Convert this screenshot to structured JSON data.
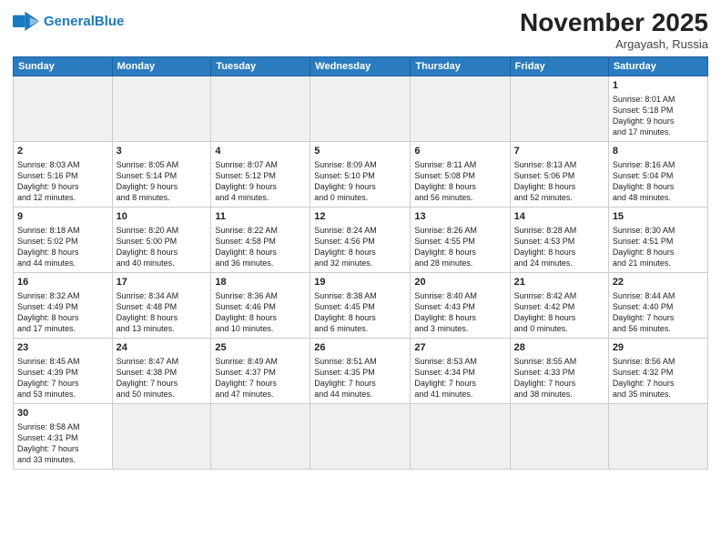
{
  "header": {
    "logo_general": "General",
    "logo_blue": "Blue",
    "month_title": "November 2025",
    "location": "Argayash, Russia"
  },
  "weekdays": [
    "Sunday",
    "Monday",
    "Tuesday",
    "Wednesday",
    "Thursday",
    "Friday",
    "Saturday"
  ],
  "weeks": [
    [
      {
        "day": "",
        "info": ""
      },
      {
        "day": "",
        "info": ""
      },
      {
        "day": "",
        "info": ""
      },
      {
        "day": "",
        "info": ""
      },
      {
        "day": "",
        "info": ""
      },
      {
        "day": "",
        "info": ""
      },
      {
        "day": "1",
        "info": "Sunrise: 8:01 AM\nSunset: 5:18 PM\nDaylight: 9 hours\nand 17 minutes."
      }
    ],
    [
      {
        "day": "2",
        "info": "Sunrise: 8:03 AM\nSunset: 5:16 PM\nDaylight: 9 hours\nand 12 minutes."
      },
      {
        "day": "3",
        "info": "Sunrise: 8:05 AM\nSunset: 5:14 PM\nDaylight: 9 hours\nand 8 minutes."
      },
      {
        "day": "4",
        "info": "Sunrise: 8:07 AM\nSunset: 5:12 PM\nDaylight: 9 hours\nand 4 minutes."
      },
      {
        "day": "5",
        "info": "Sunrise: 8:09 AM\nSunset: 5:10 PM\nDaylight: 9 hours\nand 0 minutes."
      },
      {
        "day": "6",
        "info": "Sunrise: 8:11 AM\nSunset: 5:08 PM\nDaylight: 8 hours\nand 56 minutes."
      },
      {
        "day": "7",
        "info": "Sunrise: 8:13 AM\nSunset: 5:06 PM\nDaylight: 8 hours\nand 52 minutes."
      },
      {
        "day": "8",
        "info": "Sunrise: 8:16 AM\nSunset: 5:04 PM\nDaylight: 8 hours\nand 48 minutes."
      }
    ],
    [
      {
        "day": "9",
        "info": "Sunrise: 8:18 AM\nSunset: 5:02 PM\nDaylight: 8 hours\nand 44 minutes."
      },
      {
        "day": "10",
        "info": "Sunrise: 8:20 AM\nSunset: 5:00 PM\nDaylight: 8 hours\nand 40 minutes."
      },
      {
        "day": "11",
        "info": "Sunrise: 8:22 AM\nSunset: 4:58 PM\nDaylight: 8 hours\nand 36 minutes."
      },
      {
        "day": "12",
        "info": "Sunrise: 8:24 AM\nSunset: 4:56 PM\nDaylight: 8 hours\nand 32 minutes."
      },
      {
        "day": "13",
        "info": "Sunrise: 8:26 AM\nSunset: 4:55 PM\nDaylight: 8 hours\nand 28 minutes."
      },
      {
        "day": "14",
        "info": "Sunrise: 8:28 AM\nSunset: 4:53 PM\nDaylight: 8 hours\nand 24 minutes."
      },
      {
        "day": "15",
        "info": "Sunrise: 8:30 AM\nSunset: 4:51 PM\nDaylight: 8 hours\nand 21 minutes."
      }
    ],
    [
      {
        "day": "16",
        "info": "Sunrise: 8:32 AM\nSunset: 4:49 PM\nDaylight: 8 hours\nand 17 minutes."
      },
      {
        "day": "17",
        "info": "Sunrise: 8:34 AM\nSunset: 4:48 PM\nDaylight: 8 hours\nand 13 minutes."
      },
      {
        "day": "18",
        "info": "Sunrise: 8:36 AM\nSunset: 4:46 PM\nDaylight: 8 hours\nand 10 minutes."
      },
      {
        "day": "19",
        "info": "Sunrise: 8:38 AM\nSunset: 4:45 PM\nDaylight: 8 hours\nand 6 minutes."
      },
      {
        "day": "20",
        "info": "Sunrise: 8:40 AM\nSunset: 4:43 PM\nDaylight: 8 hours\nand 3 minutes."
      },
      {
        "day": "21",
        "info": "Sunrise: 8:42 AM\nSunset: 4:42 PM\nDaylight: 8 hours\nand 0 minutes."
      },
      {
        "day": "22",
        "info": "Sunrise: 8:44 AM\nSunset: 4:40 PM\nDaylight: 7 hours\nand 56 minutes."
      }
    ],
    [
      {
        "day": "23",
        "info": "Sunrise: 8:45 AM\nSunset: 4:39 PM\nDaylight: 7 hours\nand 53 minutes."
      },
      {
        "day": "24",
        "info": "Sunrise: 8:47 AM\nSunset: 4:38 PM\nDaylight: 7 hours\nand 50 minutes."
      },
      {
        "day": "25",
        "info": "Sunrise: 8:49 AM\nSunset: 4:37 PM\nDaylight: 7 hours\nand 47 minutes."
      },
      {
        "day": "26",
        "info": "Sunrise: 8:51 AM\nSunset: 4:35 PM\nDaylight: 7 hours\nand 44 minutes."
      },
      {
        "day": "27",
        "info": "Sunrise: 8:53 AM\nSunset: 4:34 PM\nDaylight: 7 hours\nand 41 minutes."
      },
      {
        "day": "28",
        "info": "Sunrise: 8:55 AM\nSunset: 4:33 PM\nDaylight: 7 hours\nand 38 minutes."
      },
      {
        "day": "29",
        "info": "Sunrise: 8:56 AM\nSunset: 4:32 PM\nDaylight: 7 hours\nand 35 minutes."
      }
    ],
    [
      {
        "day": "30",
        "info": "Sunrise: 8:58 AM\nSunset: 4:31 PM\nDaylight: 7 hours\nand 33 minutes."
      },
      {
        "day": "",
        "info": ""
      },
      {
        "day": "",
        "info": ""
      },
      {
        "day": "",
        "info": ""
      },
      {
        "day": "",
        "info": ""
      },
      {
        "day": "",
        "info": ""
      },
      {
        "day": "",
        "info": ""
      }
    ]
  ]
}
